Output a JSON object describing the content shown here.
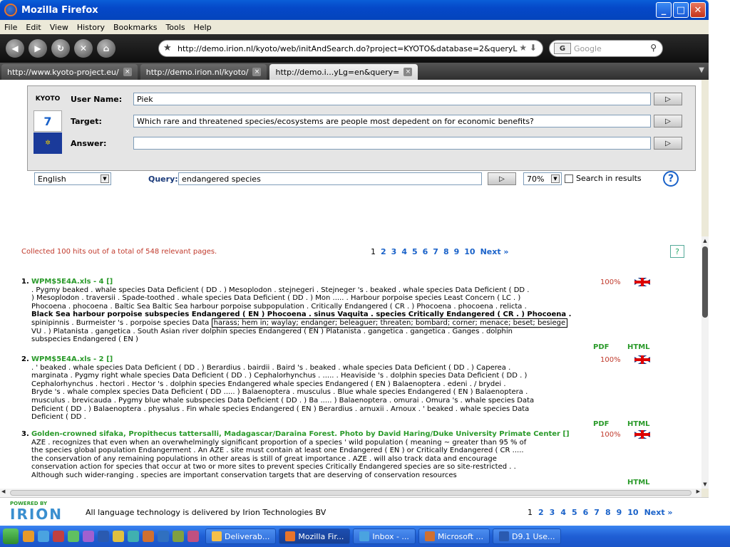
{
  "window": {
    "title": "Mozilla Firefox"
  },
  "menu": [
    "File",
    "Edit",
    "View",
    "History",
    "Bookmarks",
    "Tools",
    "Help"
  ],
  "nav": {
    "url": "http://demo.irion.nl/kyoto/web/initAndSearch.do?project=KYOTO&database=2&queryL",
    "search_placeholder": "Google",
    "search_engine": "G"
  },
  "tabs": [
    {
      "label": "http://www.kyoto-project.eu/",
      "active": false
    },
    {
      "label": "http://demo.irion.nl/kyoto/",
      "active": false
    },
    {
      "label": "http://demo.i...yLg=en&query=",
      "active": true
    }
  ],
  "panel": {
    "logo_text": "KYOTO",
    "user_label": "User Name:",
    "user_value": "Piek",
    "target_label": "Target:",
    "target_value": "Which rare and threatened species/ecosystems are people most depedent on for economic benefits?",
    "answer_label": "Answer:",
    "answer_value": "",
    "language": "English",
    "query_label": "Query:",
    "query_value": "endangered species",
    "zoom": "70%",
    "search_in_results": "Search in results",
    "help": "?"
  },
  "results_header": {
    "hits_text": "Collected 100 hits out of a total of 548 relevant pages.",
    "pages": [
      "1",
      "2",
      "3",
      "4",
      "5",
      "6",
      "7",
      "8",
      "9",
      "10"
    ],
    "next": "Next »",
    "help": "?"
  },
  "results": [
    {
      "num": "1.",
      "title": "WPM$5E4A.xls - 4 []",
      "score": "100%",
      "lines": [
        ". Pygmy beaked . whale species Data Deficient ( DD . ) Mesoplodon . stejnegeri . Stejneger 's . beaked . whale species Data Deficient ( DD .",
        ") Mesoplodon . traversii . Spade-toothed . whale species Data Deficient ( DD . ) Mon ..... . Harbour porpoise species Least Concern ( LC . )",
        "Phocoena . phocoena . Baltic Sea Baltic Sea harbour porpoise subpopulation . Critically Endangered ( CR . ) Phocoena . phocoena . relicta .",
        "Black Sea harbour porpoise subspecies Endangered ( EN ) Phocoena . sinus Vaquita . species Critically Endangered ( CR . ) Phocoena .",
        "spinipinnis . Burmeister 's . porpoise species Data",
        "VU . ) Platanista . gangetica . South Asian river dolphin species Endangered ( EN ) Platanista . gangetica . gangetica . Ganges . dolphin",
        "subspecies Endangered ( EN )"
      ],
      "tooltip": "harass; hem in; waylay; endanger; beleaguer; threaten; bombard; corner; menace; beset; besiege",
      "pdf": "PDF",
      "html": "HTML"
    },
    {
      "num": "2.",
      "title": "WPM$5E4A.xls - 2 []",
      "score": "100%",
      "lines": [
        ". ' beaked . whale species Data Deficient ( DD . ) Berardius . bairdii . Baird 's . beaked . whale species Data Deficient ( DD . ) Caperea .",
        "marginata . Pygmy right whale species Data Deficient ( DD . ) Cephalorhynchus . ..... . Heaviside 's . dolphin species Data Deficient ( DD . )",
        "Cephalorhynchus . hectori . Hector 's . dolphin species Endangered whale species Endangered ( EN ) Balaenoptera . edeni . / brydei .",
        "Bryde 's . whale complex species Data Deficient ( DD ..... ) Balaenoptera . musculus . Blue whale species Endangered ( EN ) Balaenoptera .",
        "musculus . brevicauda . Pygmy blue whale subspecies Data Deficient ( DD . ) Ba ..... ) Balaenoptera . omurai . Omura 's . whale species Data",
        "Deficient ( DD . ) Balaenoptera . physalus . Fin whale species Endangered ( EN ) Berardius . arnuxii . Arnoux . ' beaked . whale species Data",
        "Deficient ( DD ."
      ],
      "pdf": "PDF",
      "html": "HTML"
    },
    {
      "num": "3.",
      "title": "Golden-crowned sifaka, Propithecus tattersalli, Madagascar/Daraina Forest. Photo by David Haring/Duke University Primate Center []",
      "score": "100%",
      "lines": [
        "AZE . recognizes that even when an overwhelmingly significant proportion of a species ' wild population ( meaning ~ greater than 95 % of",
        "the species global population Endangerment . An AZE . site must contain at least one Endangered ( EN ) or Critically Endangered ( CR .....",
        "the conservation of any remaining populations in other areas is still of great importance . AZE . will also track data and encourage",
        "conservation action for species that occur at two or more sites to prevent species Critically Endangered species are so site-restricted . .",
        "Although such wider-ranging . species are important conservation targets that are deserving of conservation resources"
      ],
      "html": "HTML"
    }
  ],
  "footer": {
    "powered_by": "POWERED BY",
    "brand": "IRION",
    "text": "All language technology is delivered by Irion Technologies BV",
    "pages": [
      "1",
      "2",
      "3",
      "4",
      "5",
      "6",
      "7",
      "8",
      "9",
      "10"
    ],
    "next": "Next »"
  },
  "taskbar": [
    {
      "label": "Deliverab...",
      "active": false
    },
    {
      "label": "Mozilla Fir...",
      "active": true
    },
    {
      "label": "Inbox - ...",
      "active": false
    },
    {
      "label": "Microsoft ...",
      "active": false
    },
    {
      "label": "D9.1 Use...",
      "active": false
    }
  ],
  "colors": {
    "accent": "#1a62c9",
    "title_green": "#2a9a2a",
    "alert_red": "#c0392b"
  }
}
